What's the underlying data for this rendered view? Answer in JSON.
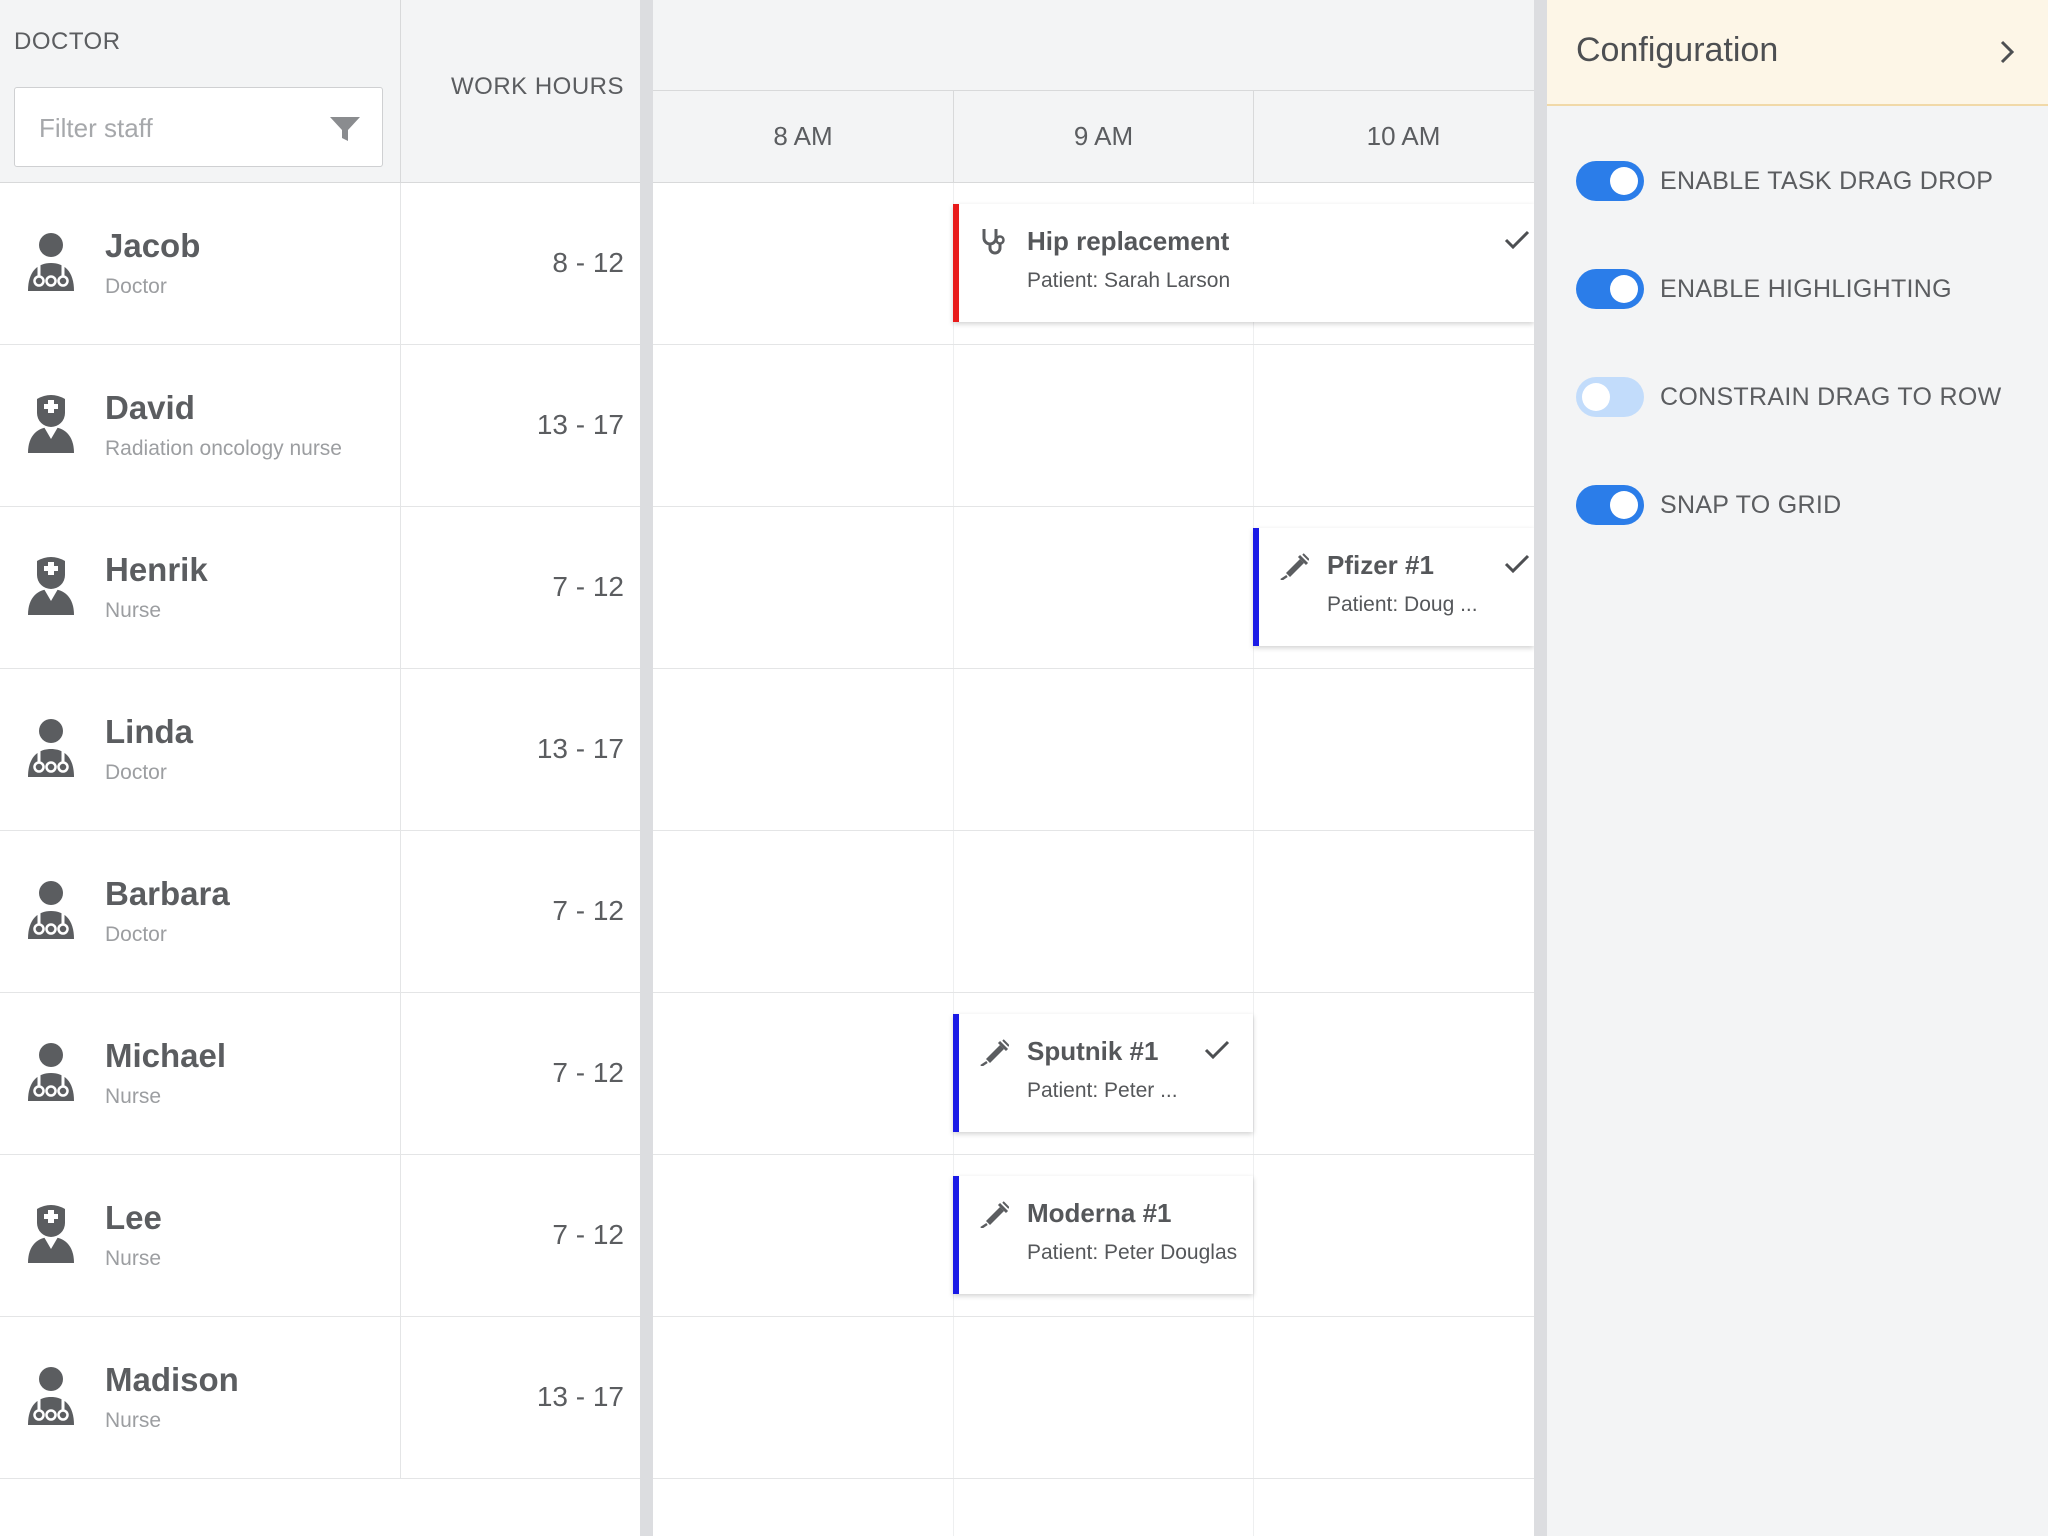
{
  "grid": {
    "doctor_header": "DOCTOR",
    "hours_header": "WORK HOURS",
    "filter_placeholder": "Filter staff",
    "resources": [
      {
        "name": "Jacob",
        "role": "Doctor",
        "hours": "8 - 12",
        "avatar": "doctor-icon"
      },
      {
        "name": "David",
        "role": "Radiation oncology nurse",
        "hours": "13 - 17",
        "avatar": "nurse-icon"
      },
      {
        "name": "Henrik",
        "role": "Nurse",
        "hours": "7 - 12",
        "avatar": "nurse-icon"
      },
      {
        "name": "Linda",
        "role": "Doctor",
        "hours": "13 - 17",
        "avatar": "doctor-icon"
      },
      {
        "name": "Barbara",
        "role": "Doctor",
        "hours": "7 - 12",
        "avatar": "doctor-icon"
      },
      {
        "name": "Michael",
        "role": "Nurse",
        "hours": "7 - 12",
        "avatar": "doctor-icon"
      },
      {
        "name": "Lee",
        "role": "Nurse",
        "hours": "7 - 12",
        "avatar": "nurse-icon"
      },
      {
        "name": "Madison",
        "role": "Nurse",
        "hours": "13 - 17",
        "avatar": "doctor-icon"
      }
    ]
  },
  "timeline": {
    "ticks": [
      "8 AM",
      "9 AM",
      "10 AM"
    ],
    "events": [
      {
        "title": "Hip replacement",
        "patient": "Patient: Sarah Larson",
        "icon": "stethoscope-icon",
        "color": "#e81b1b",
        "done": true
      },
      {
        "title": "Pfizer #1",
        "patient": "Patient: Doug ...",
        "icon": "syringe-icon",
        "color": "#1a1ae6",
        "done": true
      },
      {
        "title": "Sputnik #1",
        "patient": "Patient: Peter ...",
        "icon": "syringe-icon",
        "color": "#1a1ae6",
        "done": true
      },
      {
        "title": "Moderna #1",
        "patient": "Patient: Peter Douglas",
        "icon": "syringe-icon",
        "color": "#1a1ae6",
        "done": false
      }
    ]
  },
  "config": {
    "title": "Configuration",
    "options": [
      {
        "label": "ENABLE TASK DRAG DROP",
        "on": true
      },
      {
        "label": "ENABLE HIGHLIGHTING",
        "on": true
      },
      {
        "label": "CONSTRAIN DRAG TO ROW",
        "on": false
      },
      {
        "label": "SNAP TO GRID",
        "on": true
      }
    ]
  },
  "colors": {
    "accent": "#2b7de9",
    "accent_off": "#c2dcfb",
    "event_blue": "#1a1ae6",
    "event_red": "#e81b1b",
    "config_header": "#fdf6e7"
  }
}
